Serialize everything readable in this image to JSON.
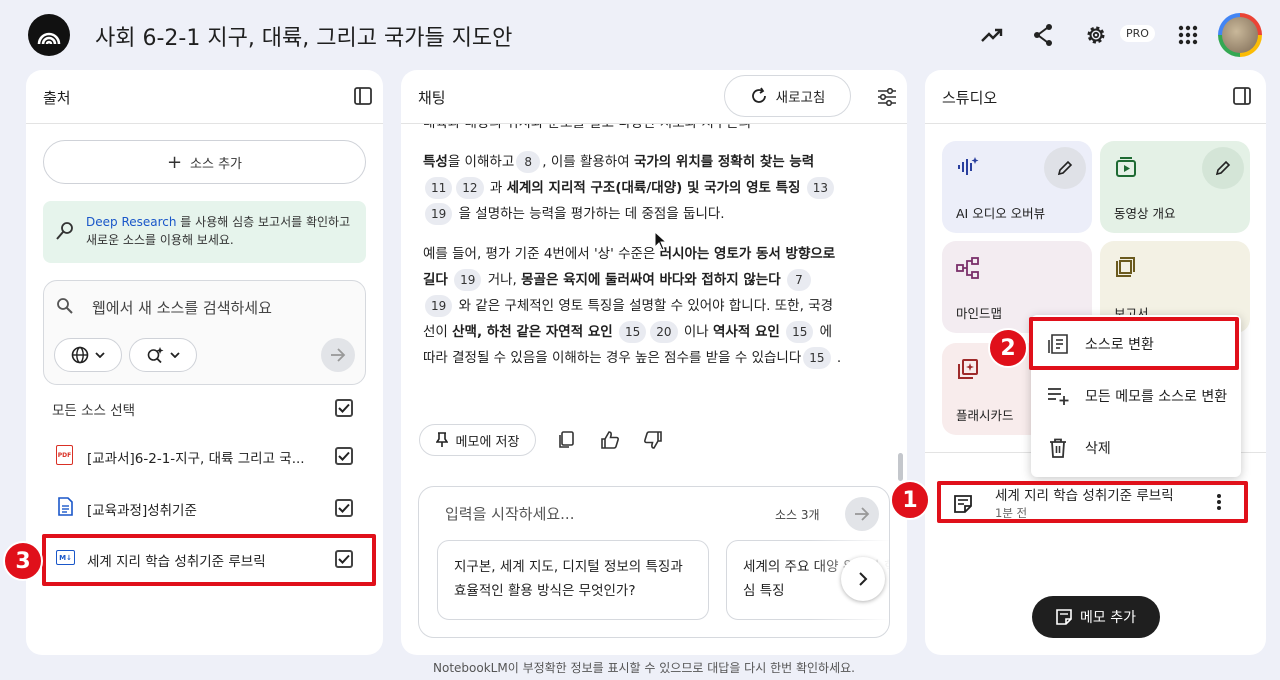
{
  "header": {
    "title": "사회 6-2-1 지구, 대륙, 그리고 국가들 지도안",
    "pro_label": "PRO"
  },
  "sources": {
    "title": "출처",
    "add_label": "소스 추가",
    "research_link": "Deep Research",
    "research_text": " 를 사용해 심층 보고서를 확인하고 새로운 소스를 이용해 보세요.",
    "search_placeholder": "웹에서 새 소스를 검색하세요",
    "select_all": "모든 소스 선택",
    "items": [
      {
        "label": "[교과서]6-2-1-지구, 대륙 그리고 국...",
        "type": "pdf"
      },
      {
        "label": "[교육과정]성취기준",
        "type": "doc"
      },
      {
        "label": "세계 지리 학습 성취기준 루브릭",
        "type": "note"
      }
    ]
  },
  "chat": {
    "title": "채팅",
    "refresh_label": "새로고침",
    "para1_cut": "대륙과 대양의 위치와 분포를 알고 다양한 지도와 지구본의",
    "p1": {
      "b1": "특성",
      "t1": "을 이해하고",
      "c1": "8",
      "t2": ", 이를 활용하여 ",
      "b2": "국가의 위치를 정확히 찾는 능력",
      "c2": "11",
      "c3": "12",
      "t3": " 과 ",
      "b3": "세계의 지리적 구조(대륙/대양) 및 국가의 영토 특징",
      "c4": "13",
      "c5": "19",
      "t4": " 을 설명하는 능력을 평가하는 데 중점을 둡니다."
    },
    "p2": {
      "t1": "예를 들어, 평가 기준 4번에서 '상' 수준은 ",
      "b1": "러시아는 영토가 동서 방향으로 길다",
      "c1": "19",
      "t2": " 거나, ",
      "b2": "몽골은 육지에 둘러싸여 바다와 접하지 않는다",
      "c2": "7",
      "c3": "19",
      "t3": " 와 같은 구체적인 영토 특징을 설명할 수 있어야 합니다. 또한, 국경선이 ",
      "b3": "산맥, 하천 같은 자연적 요인",
      "c4": "15",
      "c5": "20",
      "t4": " 이나 ",
      "b4": "역사적 요인",
      "c6": "15",
      "t5": " 에 따라 결정될 수 있음을 이해하는 경우 높은 점수를 받을 수 있습니다",
      "c7": "15",
      "t6": " ."
    },
    "save_memo": "메모에 저장",
    "input_placeholder": "입력을 시작하세요...",
    "source_count": "소스 3개",
    "suggestions": [
      "지구본, 세계 지도, 디지털 정보의 특징과 효율적인 활용 방식은 무엇인가?",
      "세계의 주요 대양 위치와 핵심 특징"
    ]
  },
  "studio": {
    "title": "스튜디오",
    "tiles": [
      {
        "label": "AI 오디오 오버뷰",
        "bg": "#eceef9"
      },
      {
        "label": "동영상 개요",
        "bg": "#e4f1e6"
      },
      {
        "label": "마인드맵",
        "bg": "#f3ecf1"
      },
      {
        "label": "보고서",
        "bg": "#f3f1e4"
      },
      {
        "label": "플래시카드",
        "bg": "#f8ecec"
      }
    ],
    "menu": [
      {
        "label": "소스로 변환"
      },
      {
        "label": "모든 메모를 소스로 변환"
      },
      {
        "label": "삭제"
      }
    ],
    "note": {
      "title": "세계 지리 학습 성취기준 루브릭",
      "time": "1분 전"
    },
    "add_note": "메모 추가"
  },
  "footer": "NotebookLM이 부정확한 정보를 표시할 수 있으므로 대답을 다시 한번 확인하세요.",
  "annotations": {
    "b1": "1",
    "b2": "2",
    "b3": "3"
  },
  "colors": {
    "accent_red": "#e0101a",
    "link_blue": "#1a57c9"
  }
}
